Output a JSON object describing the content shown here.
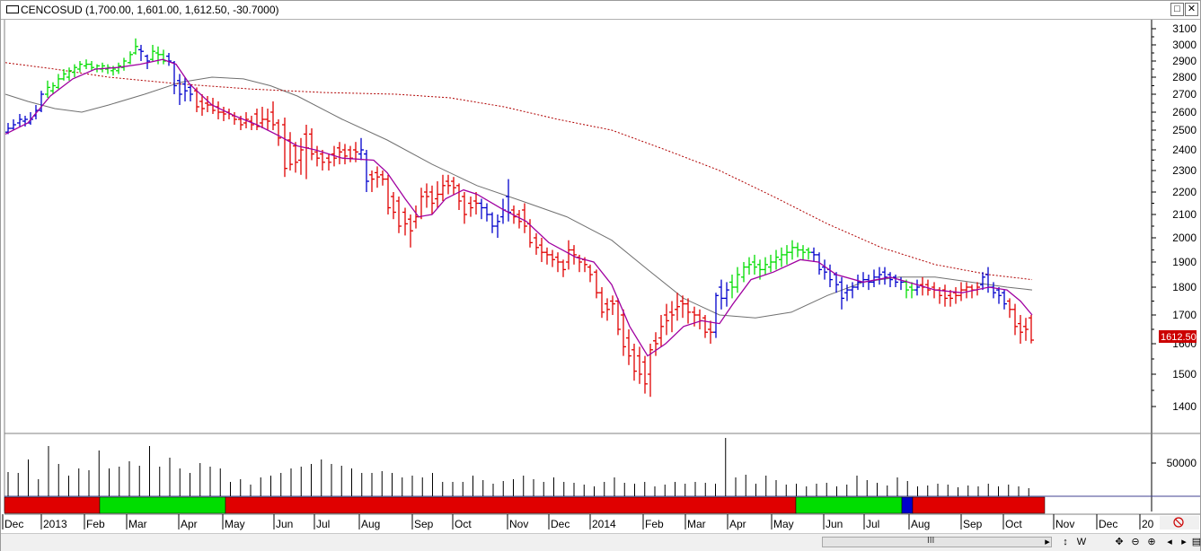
{
  "window": {
    "title": "CENCOSUD (1,700.00, 1,601.00, 1,612.50, -30.7000)",
    "minimize_glyph": "□",
    "close_glyph": "✕"
  },
  "price_axis": {
    "ticks": [
      "3100",
      "3000",
      "2900",
      "2800",
      "2700",
      "2600",
      "2500",
      "2400",
      "2300",
      "2200",
      "2100",
      "2000",
      "1900",
      "1800",
      "1700",
      "1600",
      "1500",
      "1400"
    ],
    "last_price_label": "1612.50",
    "last_price": 1612.5
  },
  "volume_axis": {
    "ticks": [
      "50000"
    ]
  },
  "time_axis": {
    "labels": [
      "Dec",
      "2013",
      "Feb",
      "Mar",
      "Apr",
      "May",
      "Jun",
      "Jul",
      "Aug",
      "Sep",
      "Oct",
      "Nov",
      "Dec",
      "2014",
      "Feb",
      "Mar",
      "Apr",
      "May",
      "Jun",
      "Jul",
      "Aug",
      "Sep",
      "Oct",
      "Nov",
      "Dec",
      "20"
    ]
  },
  "colors": {
    "up": "#00dd00",
    "down": "#e00000",
    "neutral": "#0000cc",
    "ma_short": "#a000a0",
    "ma_long": "#707070",
    "ma_dotted": "#b00000",
    "price_flag_bg": "#cc0000"
  },
  "status": {
    "scroll_grip": "III",
    "nav_icons": [
      "◂",
      "▸",
      "↕",
      "W",
      "✥",
      "⊖",
      "⊕",
      "◂",
      "▸",
      "▤"
    ]
  }
}
